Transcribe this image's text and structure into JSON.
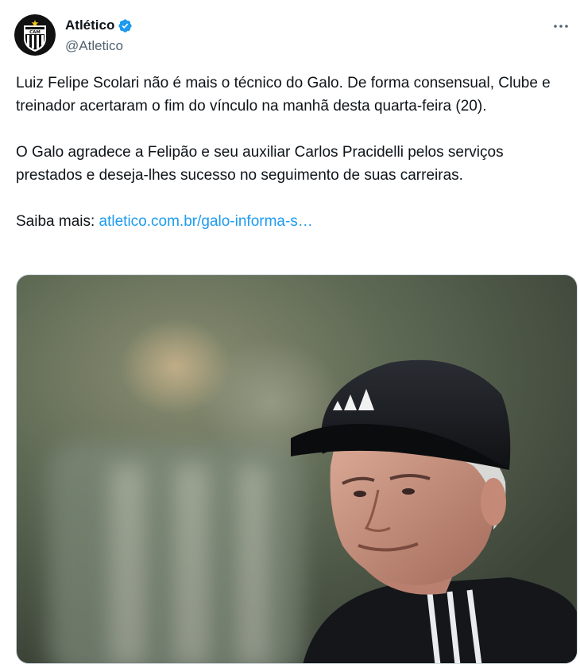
{
  "tweet": {
    "author": {
      "display_name": "Atlético",
      "handle": "@Atletico",
      "avatar_icon": "atletico-mineiro-crest-icon",
      "verified_icon": "verified-badge-icon",
      "verified_color": "#1d9bf0"
    },
    "more_icon": "more-options-icon",
    "paragraphs": [
      "Luiz Felipe Scolari não é mais o técnico do Galo. De forma consensual, Clube e treinador acertaram o fim do vínculo na manhã desta quarta-feira (20).",
      "O Galo agradece a Felipão e seu auxiliar Carlos Pracidelli pelos serviços prestados e deseja-lhes sucesso no seguimento de suas carreiras."
    ],
    "link_prefix": "Saiba mais: ",
    "link_text": "atletico.com.br/galo-informa-s…",
    "link_color": "#1d9bf0",
    "media": {
      "description_icon": "photo-coach-in-cap-icon"
    }
  }
}
